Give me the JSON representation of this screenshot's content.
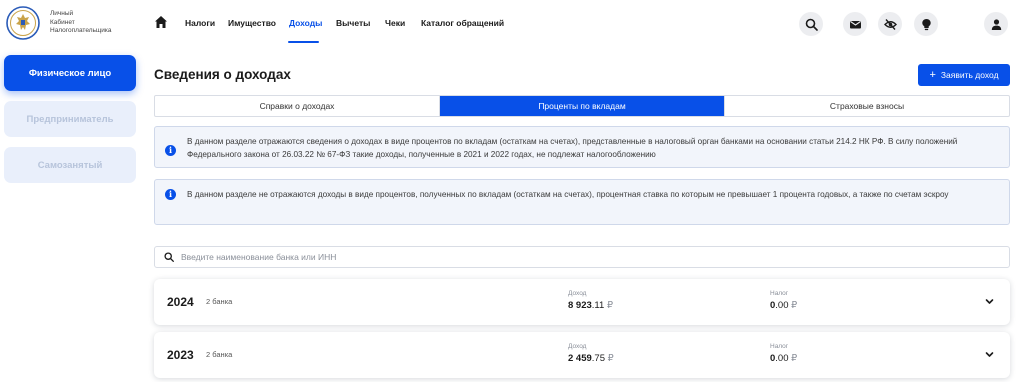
{
  "logo": {
    "line1": "Личный",
    "line2": "Кабинет",
    "line3": "Налогоплательщика"
  },
  "sidebar": {
    "items": [
      {
        "label": "Физическое лицо"
      },
      {
        "label": "Предприниматель"
      },
      {
        "label": "Самозанятый"
      }
    ]
  },
  "nav": {
    "items": [
      {
        "label": "Налоги"
      },
      {
        "label": "Имущество"
      },
      {
        "label": "Доходы"
      },
      {
        "label": "Вычеты"
      },
      {
        "label": "Чеки"
      },
      {
        "label": "Каталог обращений"
      }
    ],
    "active": "Доходы"
  },
  "page": {
    "title": "Сведения о доходах",
    "claim_button": "Заявить доход"
  },
  "tabs": [
    {
      "label": "Справки о доходах"
    },
    {
      "label": "Проценты по вкладам"
    },
    {
      "label": "Страховые взносы"
    }
  ],
  "info": {
    "first": "В данном разделе отражаются сведения о доходах в виде процентов по вкладам (остаткам на счетах), представленные в налоговый орган банками на основании статьи 214.2 НК РФ. В силу положений Федерального закона от 26.03.22 № 67-ФЗ такие доходы, полученные в 2021 и 2022 годах, не подлежат налогообложению",
    "second": "В данном разделе не отражаются доходы в виде процентов, полученных по вкладам (остаткам на счетах), процентная ставка по которым не превышает 1 процента годовых, а также по счетам эскроу"
  },
  "search": {
    "placeholder": "Введите наименование банка или ИНН",
    "value": ""
  },
  "years": [
    {
      "year": "2024",
      "banks": "2 банка",
      "income_label": "Доход",
      "income_whole": "8 923",
      "income_fraction": ".11",
      "income_currency": "₽",
      "tax_label": "Налог",
      "tax_whole": "0",
      "tax_fraction": ".00",
      "tax_currency": "₽"
    },
    {
      "year": "2023",
      "banks": "2 банка",
      "income_label": "Доход",
      "income_whole": "2 459",
      "income_fraction": ".75",
      "income_currency": "₽",
      "tax_label": "Налог",
      "tax_whole": "0",
      "tax_fraction": ".00",
      "tax_currency": "₽"
    }
  ],
  "icons": {
    "home": "home-icon",
    "search": "search-icon",
    "mail": "mail-icon",
    "visibility": "eye-off-icon",
    "hint": "lightbulb-icon",
    "profile": "user-icon",
    "info": "info-icon",
    "expand": "chevron-down-icon"
  },
  "colors": {
    "accent": "#0850e8",
    "info_bg": "#f2f5fb",
    "sidebar_idle_bg": "#e9effb",
    "sidebar_idle_text": "#b7c4db"
  }
}
